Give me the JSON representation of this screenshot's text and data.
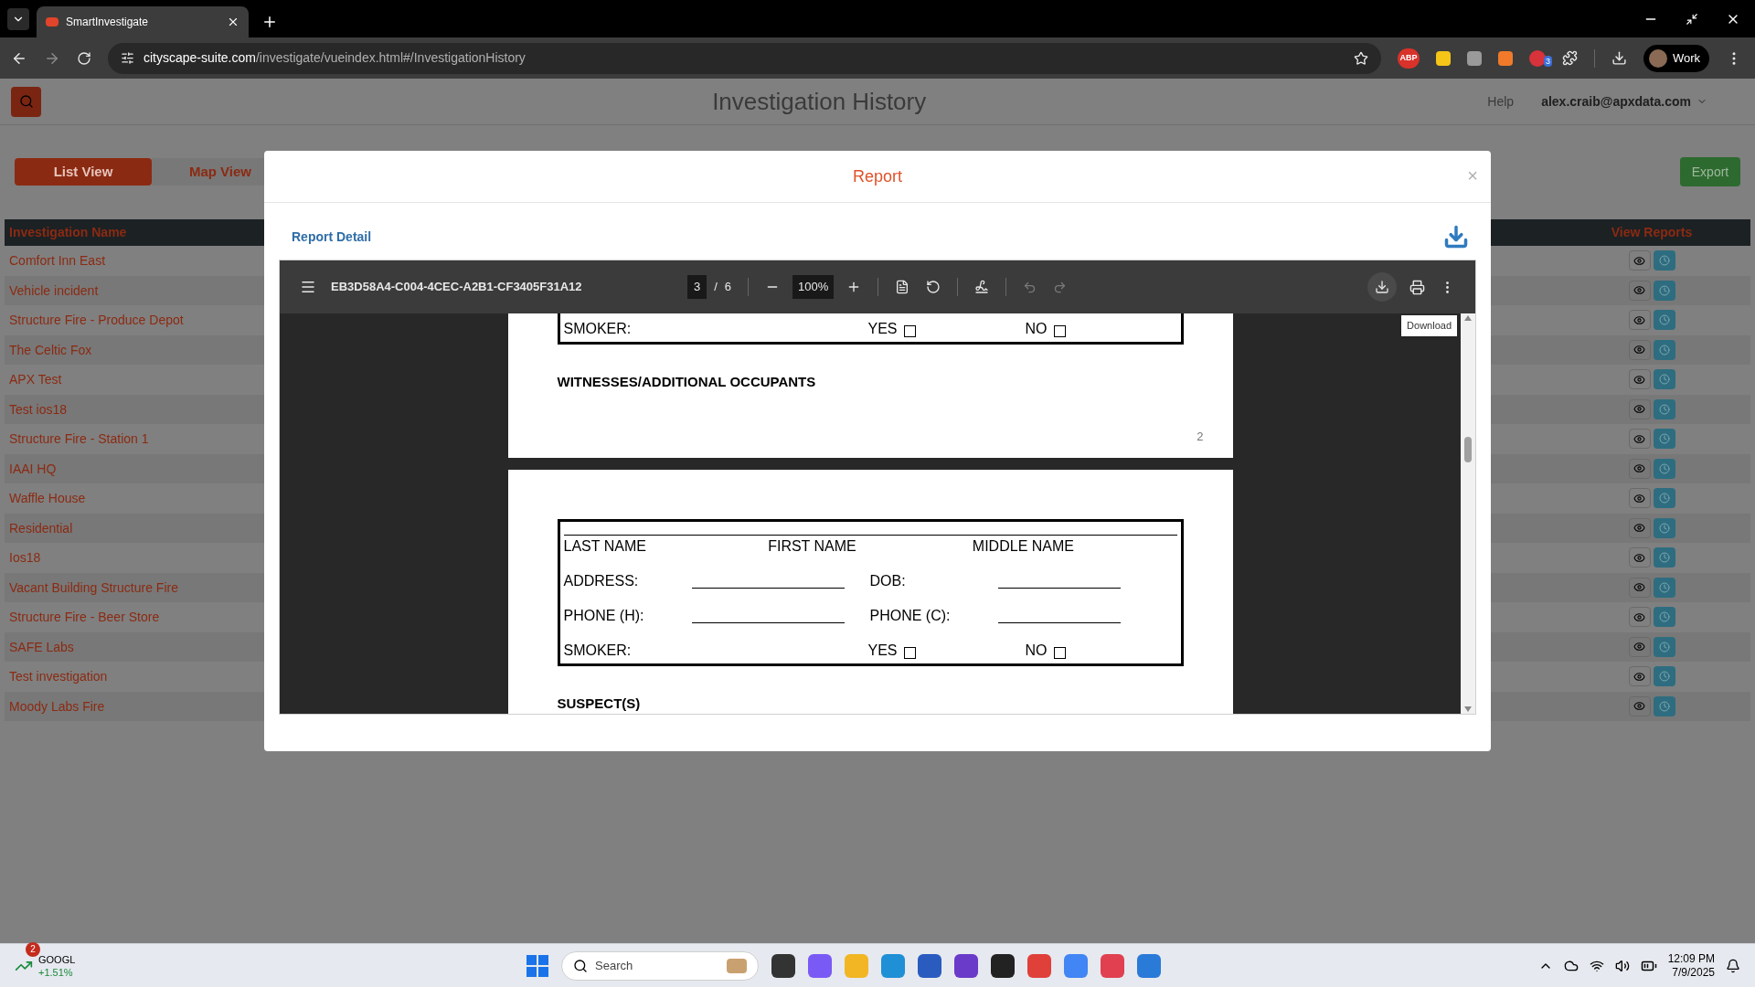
{
  "browser": {
    "tabs": [
      {
        "title": "SmartInvestigate",
        "selected": true
      }
    ],
    "url_host": "cityscape-suite.com",
    "url_path": "/investigate/vueindex.html#/InvestigationHistory",
    "extension_label": "ABP",
    "extension_badge": "3",
    "profile": "Work"
  },
  "app": {
    "title": "Investigation History",
    "help": "Help",
    "user": "alex.craib@apxdata.com",
    "view_tabs": [
      {
        "label": "List View",
        "selected": true
      },
      {
        "label": "Map View",
        "selected": false
      }
    ],
    "export": "Export",
    "table": {
      "columns": [
        "Investigation Name",
        "View Reports"
      ],
      "rows": [
        "Comfort Inn East",
        "Vehicle incident",
        "Structure Fire - Produce Depot",
        "The Celtic Fox",
        "APX Test",
        "Test ios18",
        "Structure Fire - Station 1",
        "IAAI HQ",
        "Waffle House",
        "Residential",
        "Ios18",
        "Vacant Building Structure Fire",
        "Structure Fire - Beer Store",
        "SAFE Labs",
        "Test investigation",
        "Moody Labs Fire"
      ]
    }
  },
  "modal": {
    "title": "Report",
    "close": "×",
    "section": "Report Detail",
    "pdf": {
      "filename": "EB3D58A4-C004-4CEC-A2B1-CF3405F31A12",
      "page": "3",
      "page_separator": "/",
      "page_count": "6",
      "zoom": "100%",
      "undo": {
        "disabled": true
      },
      "redo": {
        "disabled": true
      },
      "download": {
        "highlighted": true
      },
      "tooltip": "Download",
      "page_tail": {
        "rows": [
          {
            "kind": "smoker",
            "label": "SMOKER:",
            "yes": "YES",
            "no": "NO"
          }
        ],
        "heading": "WITNESSES/ADDITIONAL OCCUPANTS",
        "page_number": "2"
      },
      "next_page": {
        "name_labels": [
          "LAST NAME",
          "FIRST NAME",
          "MIDDLE NAME"
        ],
        "rows": [
          {
            "kind": "fields",
            "left": "ADDRESS:",
            "right": "DOB:"
          },
          {
            "kind": "fields",
            "left": "PHONE (H):",
            "right": "PHONE (C):"
          },
          {
            "kind": "smoker",
            "label": "SMOKER:",
            "yes": "YES",
            "no": "NO"
          }
        ],
        "heading": "SUSPECT(S)"
      }
    }
  },
  "taskbar": {
    "stock": "GOOGL",
    "stock_change": "+1.51%",
    "stock_badge": "2",
    "search_placeholder": "Search",
    "time": "12:09 PM",
    "date": "7/9/2025"
  }
}
